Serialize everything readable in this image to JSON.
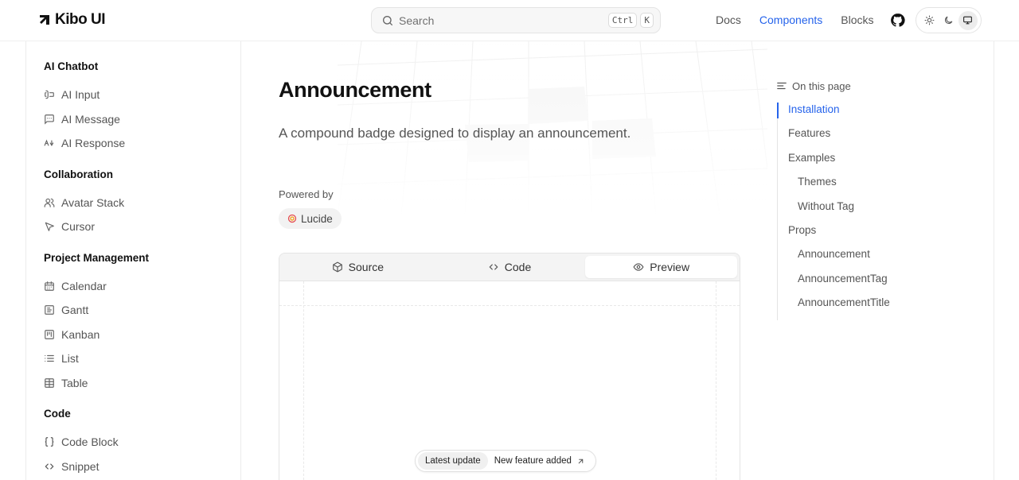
{
  "header": {
    "logo_text": "Kibo UI",
    "search_placeholder": "Search",
    "shortcut_keys": [
      "Ctrl",
      "K"
    ],
    "nav": [
      {
        "label": "Docs",
        "active": false
      },
      {
        "label": "Components",
        "active": true
      },
      {
        "label": "Blocks",
        "active": false
      }
    ],
    "theme_options": [
      "light",
      "dark",
      "system"
    ],
    "theme_selected": "system"
  },
  "sidebar": {
    "groups": [
      {
        "title": "AI Chatbot",
        "items": [
          {
            "label": "AI Input",
            "icon": "text-cursor-input-icon"
          },
          {
            "label": "AI Message",
            "icon": "message-square-icon"
          },
          {
            "label": "AI Response",
            "icon": "case-sensitive-icon"
          }
        ]
      },
      {
        "title": "Collaboration",
        "items": [
          {
            "label": "Avatar Stack",
            "icon": "users-icon"
          },
          {
            "label": "Cursor",
            "icon": "mouse-pointer-icon"
          }
        ]
      },
      {
        "title": "Project Management",
        "items": [
          {
            "label": "Calendar",
            "icon": "calendar-icon"
          },
          {
            "label": "Gantt",
            "icon": "gantt-chart-icon"
          },
          {
            "label": "Kanban",
            "icon": "kanban-icon"
          },
          {
            "label": "List",
            "icon": "list-icon"
          },
          {
            "label": "Table",
            "icon": "table-icon"
          }
        ]
      },
      {
        "title": "Code",
        "items": [
          {
            "label": "Code Block",
            "icon": "braces-icon"
          },
          {
            "label": "Snippet",
            "icon": "code-icon"
          }
        ]
      }
    ]
  },
  "main": {
    "title": "Announcement",
    "description": "A compound badge designed to display an announcement.",
    "powered_by_label": "Powered by",
    "powered_by": "Lucide",
    "tabs": [
      {
        "label": "Source",
        "icon": "package-icon",
        "active": false
      },
      {
        "label": "Code",
        "icon": "code-icon",
        "active": false
      },
      {
        "label": "Preview",
        "icon": "eye-icon",
        "active": true
      }
    ],
    "preview": {
      "tag": "Latest update",
      "title": "New feature added"
    }
  },
  "toc": {
    "header": "On this page",
    "items": [
      {
        "label": "Installation",
        "level": 1,
        "active": true
      },
      {
        "label": "Features",
        "level": 1,
        "active": false
      },
      {
        "label": "Examples",
        "level": 1,
        "active": false
      },
      {
        "label": "Themes",
        "level": 2,
        "active": false
      },
      {
        "label": "Without Tag",
        "level": 2,
        "active": false
      },
      {
        "label": "Props",
        "level": 1,
        "active": false
      },
      {
        "label": "Announcement",
        "level": 2,
        "active": false
      },
      {
        "label": "AnnouncementTag",
        "level": 2,
        "active": false
      },
      {
        "label": "AnnouncementTitle",
        "level": 2,
        "active": false
      }
    ]
  },
  "colors": {
    "accent": "#2563eb",
    "text": "#111111",
    "muted": "#555555",
    "border": "#e4e4e4"
  }
}
